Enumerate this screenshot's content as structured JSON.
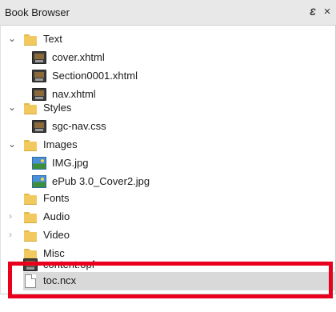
{
  "panel": {
    "title": "Book Browser",
    "float_button": "Ɛ",
    "close_button": "×"
  },
  "tree": [
    {
      "label": "Text",
      "type": "folder",
      "expanded": true,
      "icon": "folder-icon"
    },
    {
      "label": "cover.xhtml",
      "type": "file",
      "icon": "xhtml-file-icon"
    },
    {
      "label": "Section0001.xhtml",
      "type": "file",
      "icon": "xhtml-file-icon"
    },
    {
      "label": "nav.xhtml",
      "type": "file",
      "icon": "xhtml-file-icon"
    },
    {
      "label": "Styles",
      "type": "folder",
      "expanded": true,
      "icon": "folder-icon"
    },
    {
      "label": "sgc-nav.css",
      "type": "file",
      "icon": "css-file-icon"
    },
    {
      "label": "Images",
      "type": "folder",
      "expanded": true,
      "icon": "folder-icon"
    },
    {
      "label": "IMG.jpg",
      "type": "file",
      "icon": "image-file-icon"
    },
    {
      "label": "ePub 3.0_Cover2.jpg",
      "type": "file",
      "icon": "image-file-icon"
    },
    {
      "label": "Fonts",
      "type": "folder",
      "expanded": false,
      "icon": "folder-icon"
    },
    {
      "label": "Audio",
      "type": "folder",
      "expanded": false,
      "icon": "folder-icon"
    },
    {
      "label": "Video",
      "type": "folder",
      "expanded": false,
      "icon": "folder-icon"
    },
    {
      "label": "Misc",
      "type": "folder",
      "expanded": false,
      "icon": "folder-icon"
    },
    {
      "label": "content.opf",
      "type": "file",
      "icon": "opf-file-icon"
    },
    {
      "label": "toc.ncx",
      "type": "file",
      "icon": "ncx-file-icon",
      "selected": true
    }
  ],
  "colors": {
    "highlight": "#e8001c",
    "selection": "#d9d9d9",
    "folder": "#f1c95f"
  }
}
